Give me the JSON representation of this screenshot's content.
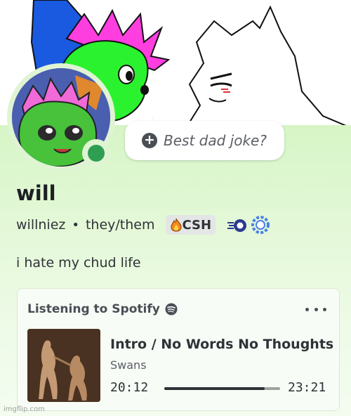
{
  "profile": {
    "display_name": "will",
    "username": "willniez",
    "separator": "•",
    "pronouns": "they/them",
    "status": "online",
    "status_color": "#2f9e52",
    "bio": "i hate my chud life",
    "clan_tag": {
      "icon": "flame-icon",
      "text": "CSH"
    },
    "badges": [
      "speed-badge-icon",
      "gear-badge-icon"
    ]
  },
  "custom_status": {
    "icon": "plus-icon",
    "placeholder": "Best dad joke?"
  },
  "activity": {
    "title": "Listening to Spotify",
    "service_icon": "spotify-icon",
    "menu_icon": "more-icon",
    "track": "Intro / No Words No Thoughts",
    "artist": "Swans",
    "elapsed": "20:12",
    "total": "23:21",
    "progress": 0.865
  },
  "watermark": "imgflip.com",
  "colors": {
    "card_gradient_top": "#d6f5c6",
    "text_primary": "#1d1f23",
    "text_secondary": "#4a4e55"
  }
}
